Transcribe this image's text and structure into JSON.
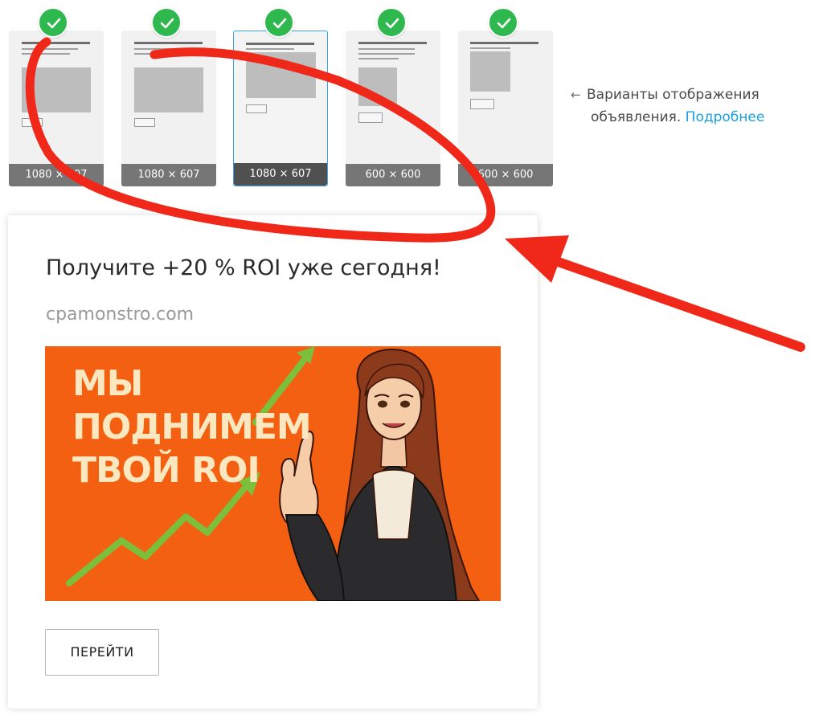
{
  "formats": [
    {
      "label": "1080 × 607",
      "selected": false
    },
    {
      "label": "1080 × 607",
      "selected": false
    },
    {
      "label": "1080 × 607",
      "selected": true
    },
    {
      "label": "600 × 600",
      "selected": false
    },
    {
      "label": "600 × 600",
      "selected": false
    }
  ],
  "note": {
    "arrow": "←",
    "text_line1": "Варианты отображения",
    "text_line2": "объявления.",
    "link": "Подробнее"
  },
  "ad": {
    "title": "Получите +20 % ROI уже сегодня!",
    "domain": "cpamonstro.com",
    "banner_lines": [
      "МЫ",
      "ПОДНИМЕМ",
      "ТВОЙ ROI"
    ],
    "button": "ПЕРЕЙТИ"
  },
  "colors": {
    "check": "#2eb84e",
    "selected_border": "#3aa3e3",
    "link": "#1a9fe0",
    "banner_bg": "#f46012",
    "banner_text": "#fbe7c0",
    "annotation_red": "#f0281a"
  },
  "icons": {
    "check": "check-icon",
    "note_arrow": "arrow-left-icon",
    "annotation": "red-circle-and-arrow"
  }
}
